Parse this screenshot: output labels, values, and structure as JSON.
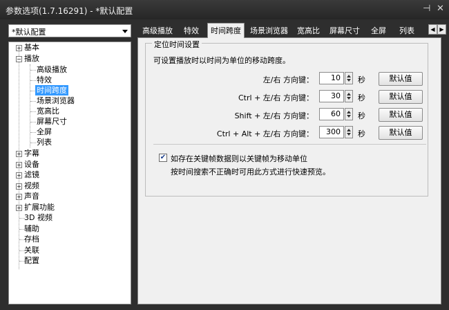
{
  "window": {
    "title": "参数选项(1.7.16291) - *默认配置",
    "pin": "⊣",
    "close": "✕"
  },
  "profile": {
    "selected": "*默认配置"
  },
  "tabs": [
    "高级播放",
    "特效",
    "时间跨度",
    "场景浏览器",
    "宽高比",
    "屏幕尺寸",
    "全屏",
    "列表"
  ],
  "active_tab": "时间跨度",
  "tree": {
    "items": [
      "基本",
      "播放",
      "高级播放",
      "特效",
      "时间跨度",
      "场景浏览器",
      "宽高比",
      "屏幕尺寸",
      "全屏",
      "列表",
      "字幕",
      "设备",
      "滤镜",
      "视频",
      "声音",
      "扩展功能",
      "3D 视频",
      "辅助",
      "存档",
      "关联",
      "配置"
    ],
    "expand_plus": "+",
    "expand_minus": "−"
  },
  "group": {
    "title": "定位时间设置",
    "description": "可设置播放时以时间为单位的移动跨度。",
    "rows": [
      {
        "label": "左/右 方向键：",
        "value": "10",
        "unit": "秒",
        "button": "默认值"
      },
      {
        "label": "Ctrl + 左/右 方向键：",
        "value": "30",
        "unit": "秒",
        "button": "默认值"
      },
      {
        "label": "Shift + 左/右 方向键：",
        "value": "60",
        "unit": "秒",
        "button": "默认值"
      },
      {
        "label": "Ctrl + Alt + 左/右 方向键：",
        "value": "300",
        "unit": "秒",
        "button": "默认值"
      }
    ],
    "checkbox": {
      "checked": true,
      "mark": "✔",
      "label": "如存在关键帧数据则以关键帧为移动单位",
      "hint": "按时间搜索不正确时可用此方式进行快速预览。"
    }
  }
}
